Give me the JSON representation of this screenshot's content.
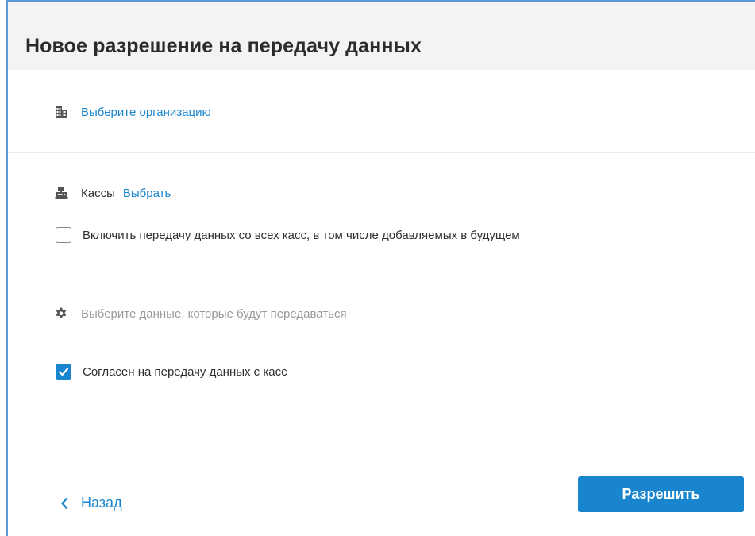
{
  "dialog": {
    "title": "Новое разрешение на передачу данных"
  },
  "organization": {
    "icon": "building-icon",
    "link_label": "Выберите организацию"
  },
  "registers": {
    "icon": "cash-register-icon",
    "label": "Кассы",
    "select_label": "Выбрать",
    "include_all": {
      "label": "Включить передачу данных со всех касс, в том числе добавляемых в будущем",
      "checked": false
    }
  },
  "data_selection": {
    "icon": "gear-icon",
    "placeholder": "Выберите данные, которые будут передаваться"
  },
  "consent": {
    "label": "Согласен на передачу данных с касс",
    "checked": true
  },
  "footer": {
    "back_icon": "chevron-left-icon",
    "back_label": "Назад",
    "submit_label": "Разрешить"
  },
  "colors": {
    "accent": "#1a85cf",
    "header_bg": "#f3f3f3"
  }
}
